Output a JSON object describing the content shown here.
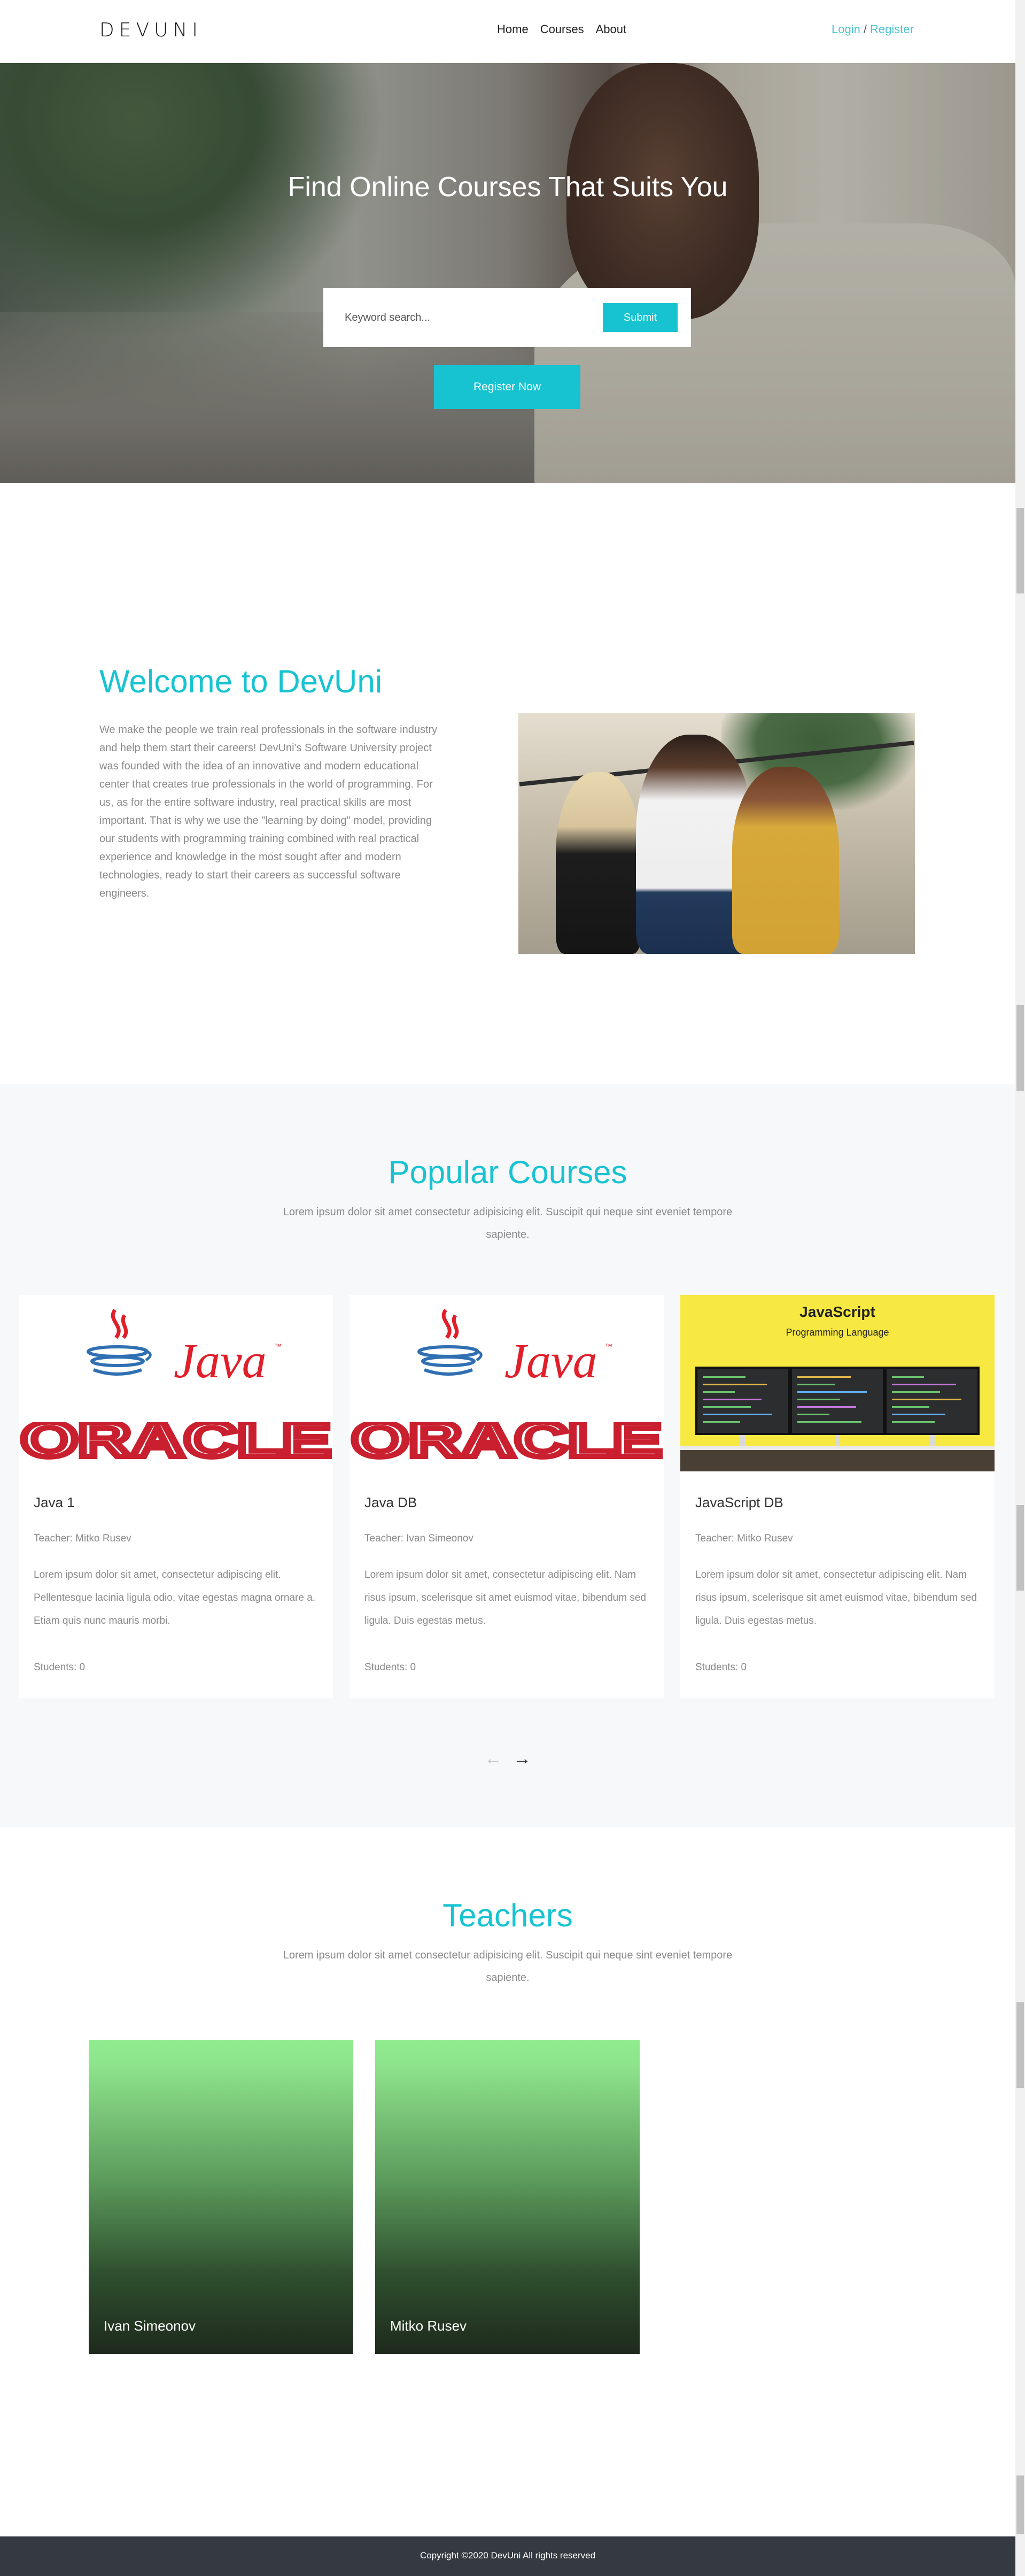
{
  "navbar": {
    "brand": "DEVUNI",
    "links": [
      "Home",
      "Courses",
      "About"
    ],
    "login": "Login",
    "separator": "/",
    "register": "Register"
  },
  "hero": {
    "title": "Find Online Courses That Suits You",
    "search_placeholder": "Keyword search...",
    "submit_label": "Submit",
    "register_now_label": "Register Now"
  },
  "welcome": {
    "title": "Welcome to DevUni",
    "text": "We make the people we train real professionals in the software industry and help them start their careers! DevUni's Software University project was founded with the idea of an innovative and modern educational center that creates true professionals in the world of programming. For us, as for the entire software industry, real practical skills are most important. That is why we use the \"learning by doing\" model, providing our students with programming training combined with real practical experience and knowledge in the most sought after and modern technologies, ready to start their careers as successful software engineers."
  },
  "popular": {
    "title": "Popular Courses",
    "subtitle": "Lorem ipsum dolor sit amet consectetur adipisicing elit. Suscipit qui neque sint eveniet tempore sapiente.",
    "courses": [
      {
        "name": "Java 1",
        "teacher": "Teacher: Mitko Rusev",
        "description": "Lorem ipsum dolor sit amet, consectetur adipiscing elit. Pellentesque lacinia ligula odio, vitae egestas magna ornare a. Etiam quis nunc mauris morbi.",
        "students": "Students: 0",
        "image_text_1": "Java",
        "image_text_2": "ORACLE"
      },
      {
        "name": "Java DB",
        "teacher": "Teacher: Ivan Simeonov",
        "description": "Lorem ipsum dolor sit amet, consectetur adipiscing elit. Nam risus ipsum, scelerisque sit amet euismod vitae, bibendum sed ligula. Duis egestas metus.",
        "students": "Students: 0",
        "image_text_1": "Java",
        "image_text_2": "ORACLE"
      },
      {
        "name": "JavaScript DB",
        "teacher": "Teacher: Mitko Rusev",
        "description": "Lorem ipsum dolor sit amet, consectetur adipiscing elit. Nam risus ipsum, scelerisque sit amet euismod vitae, bibendum sed ligula. Duis egestas metus.",
        "students": "Students: 0",
        "image_text_1": "JavaScript",
        "image_text_2": "Programming Language"
      }
    ],
    "prev_arrow": "←",
    "next_arrow": "→"
  },
  "teachers": {
    "title": "Teachers",
    "subtitle": "Lorem ipsum dolor sit amet consectetur adipisicing elit. Suscipit qui neque sint eveniet tempore sapiente.",
    "list": [
      "Ivan Simeonov",
      "Mitko Rusev"
    ]
  },
  "footer": {
    "text": "Copyright ©2020 DevUni All rights reserved"
  },
  "colors": {
    "accent": "#17c3d1",
    "link": "#4bc4d0",
    "footer_bg": "#343a40",
    "section_bg": "#f7f8fa",
    "java_red": "#e11f2a",
    "js_yellow": "#f7e942"
  }
}
